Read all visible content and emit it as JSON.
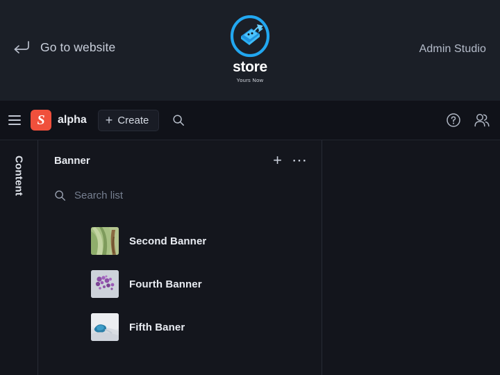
{
  "header": {
    "back_link_label": "Go to website",
    "back_icon": "return-arrow-icon",
    "brand_name": "store",
    "brand_tagline": "Yours Now",
    "brand_icon": "store-laptop-arrow-logo",
    "right_label": "Admin Studio",
    "bg_color": "#1b1f27"
  },
  "toolbar": {
    "menu_icon": "hamburger-icon",
    "workspace_initial": "S",
    "workspace_name": "alpha",
    "workspace_color": "#f0503c",
    "create_label": "Create",
    "create_icon": "plus-icon",
    "search_icon": "search-icon",
    "help_icon": "help-circle-icon",
    "users_icon": "users-icon",
    "bg_color": "#101219"
  },
  "rail": {
    "label": "Content"
  },
  "list_pane": {
    "title": "Banner",
    "add_icon": "plus-icon",
    "add_label": "+",
    "more_icon": "ellipsis-icon",
    "more_label": "⋯",
    "search": {
      "icon": "search-icon",
      "value": "",
      "placeholder": "Search list"
    },
    "items": [
      {
        "title": "Second Banner",
        "thumb": "green-leaf-thumbnail"
      },
      {
        "title": "Fourth Banner",
        "thumb": "purple-berries-thumbnail"
      },
      {
        "title": "Fifth Baner",
        "thumb": "blue-splash-thumbnail"
      }
    ]
  }
}
